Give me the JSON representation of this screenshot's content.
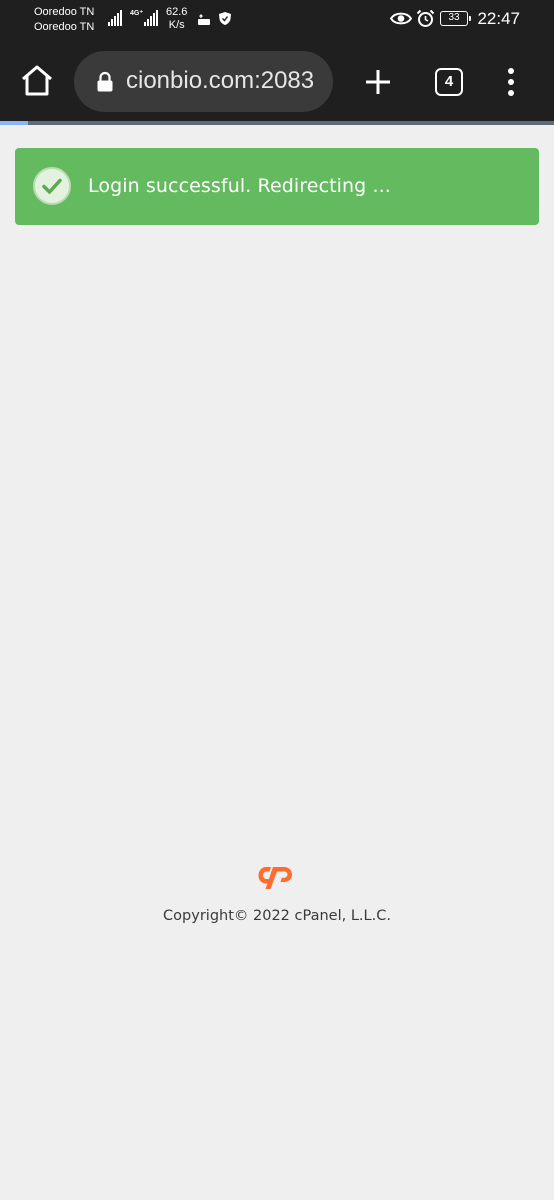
{
  "status_bar": {
    "carrier_1": "Ooredoo TN",
    "carrier_2": "Ooredoo TN",
    "network_type": "4G⁺",
    "speed_value": "62.6",
    "speed_unit": "K/s",
    "battery": "33",
    "time": "22:47"
  },
  "browser": {
    "url": "cionbio.com:2083",
    "tab_count": "4",
    "load_progress": 0.05
  },
  "alert": {
    "message": "Login successful. Redirecting ...",
    "color": "#64bb5f"
  },
  "footer": {
    "logo": "cP",
    "logo_color": "#ff6c2c",
    "copyright": "Copyright© 2022 cPanel, L.L.C."
  }
}
